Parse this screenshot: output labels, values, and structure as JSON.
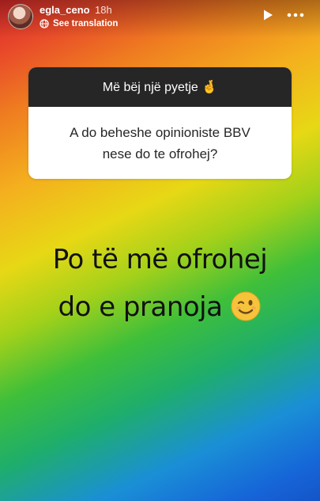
{
  "header": {
    "username": "egla_ceno",
    "time": "18h",
    "translate_label": "See translation"
  },
  "question": {
    "prompt": "Më bëj një pyetje 🤞",
    "line1": "A do beheshe opinioniste BBV",
    "line2": "nese do te ofrohej?"
  },
  "answer": {
    "line1": "Po të më ofrohej",
    "line2": "do e pranoja"
  },
  "colors": {
    "question_header_bg": "#262626",
    "question_body_bg": "#ffffff"
  }
}
